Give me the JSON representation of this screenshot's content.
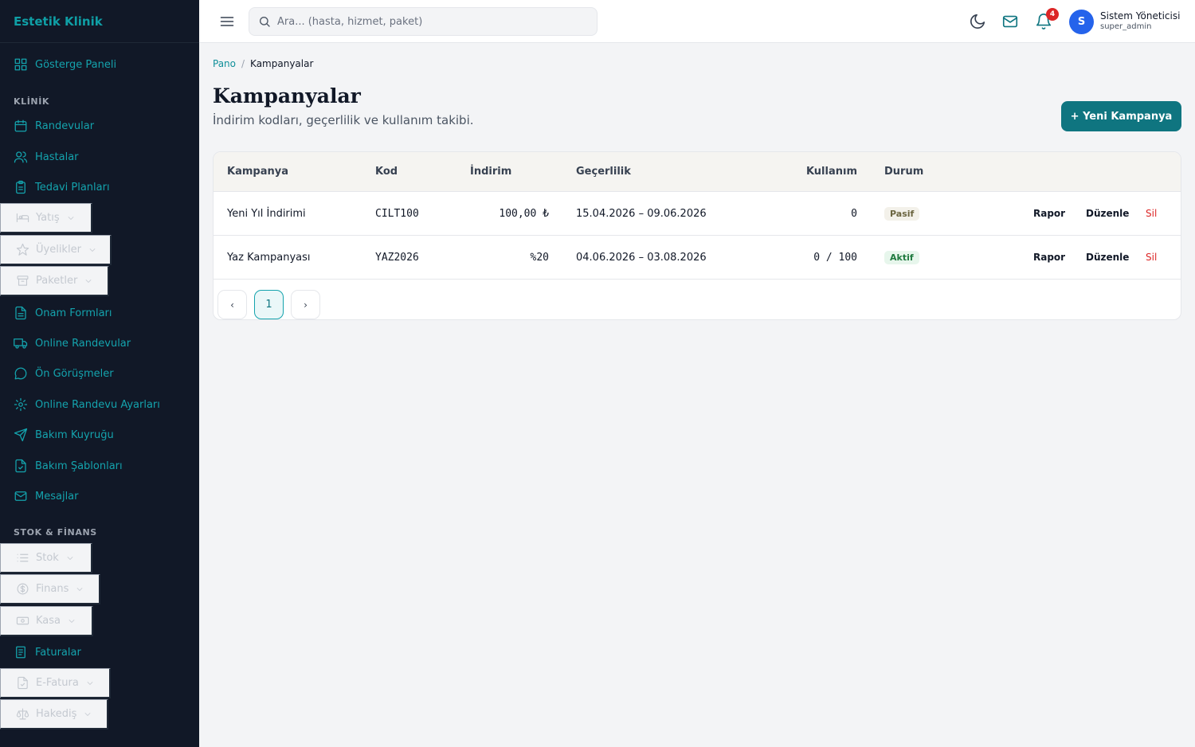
{
  "app": {
    "brand": "Estetik Klinik"
  },
  "sidebar": {
    "dashboard": "Gösterge Paneli",
    "section_clinic": "KLİNİK",
    "section_finance": "STOK & FİNANS",
    "items": {
      "randevular": "Randevular",
      "hastalar": "Hastalar",
      "tedavi": "Tedavi Planları",
      "yatis": "Yatış",
      "uyelikler": "Üyelikler",
      "paketler": "Paketler",
      "onam": "Onam Formları",
      "online_randevular": "Online Randevular",
      "on_gorusmeler": "Ön Görüşmeler",
      "online_ayarlar": "Online Randevu Ayarları",
      "bakim_kuyrugu": "Bakım Kuyruğu",
      "bakim_sablonlari": "Bakım Şablonları",
      "mesajlar": "Mesajlar",
      "stok": "Stok",
      "finans": "Finans",
      "kasa": "Kasa",
      "faturalar": "Faturalar",
      "efatura": "E-Fatura",
      "hakedis": "Hakediş"
    }
  },
  "topbar": {
    "search_placeholder": "Ara... (hasta, hizmet, paket)",
    "notification_count": "4",
    "user_initial": "S",
    "user_name": "Sistem Yöneticisi",
    "user_role": "super_admin"
  },
  "breadcrumb": {
    "home": "Pano",
    "sep": "/",
    "current": "Kampanyalar"
  },
  "page": {
    "title": "Kampanyalar",
    "subtitle": "İndirim kodları, geçerlilik ve kullanım takibi.",
    "new_button": "+ Yeni Kampanya"
  },
  "table": {
    "headers": {
      "kampanya": "Kampanya",
      "kod": "Kod",
      "indirim": "İndirim",
      "gecerlilik": "Geçerlilik",
      "kullanim": "Kullanım",
      "durum": "Durum"
    },
    "rows": [
      {
        "name": "Yeni Yıl İndirimi",
        "code": "CILT100",
        "discount": "100,00 ₺",
        "validity": "15.04.2026 – 09.06.2026",
        "usage": "0",
        "status": "Pasif",
        "report": "Rapor",
        "edit": "Düzenle",
        "delete": "Sil"
      },
      {
        "name": "Yaz Kampanyası",
        "code": "YAZ2026",
        "discount": "%20",
        "validity": "04.06.2026 – 03.08.2026",
        "usage": "0 / 100",
        "status": "Aktif",
        "report": "Rapor",
        "edit": "Düzenle",
        "delete": "Sil"
      }
    ]
  },
  "pagination": {
    "prev": "‹",
    "page": "1",
    "next": "›"
  },
  "colors": {
    "sidebar_bg": "#111827",
    "accent": "#0f7580",
    "badge": "#dc2626",
    "avatar": "#2563eb"
  }
}
